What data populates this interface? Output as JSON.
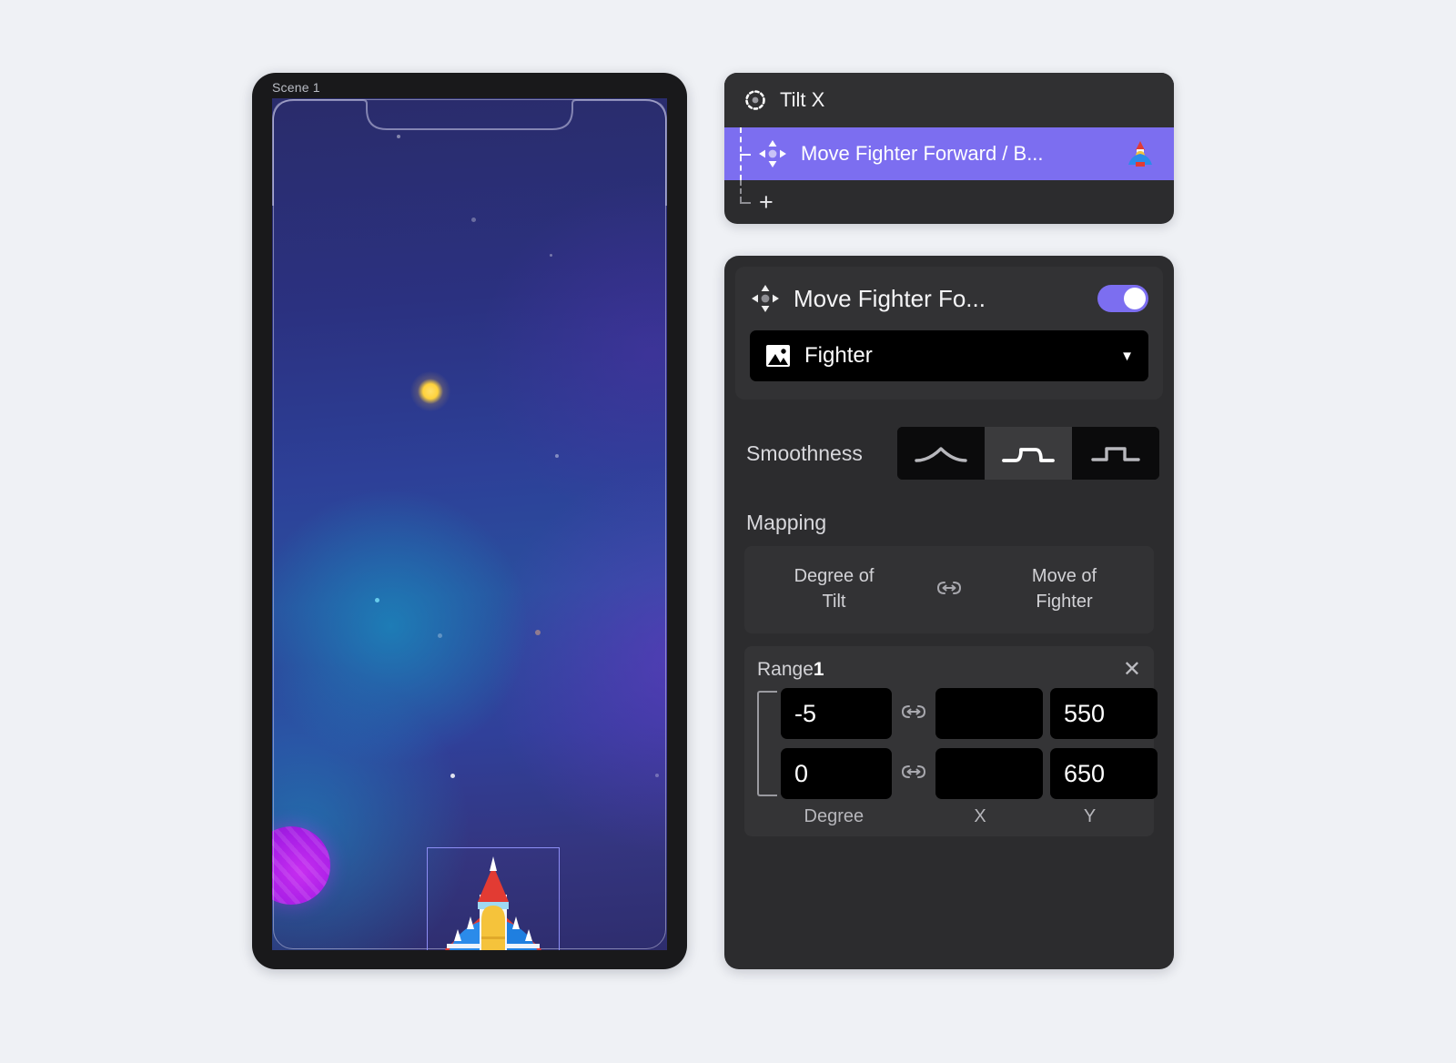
{
  "preview": {
    "scene_label": "Scene 1",
    "selected_sprite": "Fighter",
    "sprite_icon": "fighter-jet-sprite",
    "planet_icon": "purple-planet"
  },
  "layers_panel": {
    "header": {
      "icon": "tilt-sensor-icon",
      "title": "Tilt X"
    },
    "rows": [
      {
        "icon": "move-arrows-icon",
        "label": "Move Fighter Forward / B...",
        "thumbnail": "fighter-thumbnail",
        "selected": true
      }
    ],
    "add_label": "+"
  },
  "inspector": {
    "icon": "move-arrows-icon",
    "title": "Move Fighter Fo...",
    "enabled_toggle": {
      "name": "behavior-enabled-toggle",
      "state": "on"
    },
    "target_select": {
      "icon": "image-icon",
      "value": "Fighter",
      "chevron": "▼"
    },
    "smoothness": {
      "label": "Smoothness",
      "options": [
        {
          "id": "smooth-curve",
          "icon": "smooth-curve-icon",
          "selected": false
        },
        {
          "id": "rounded-step",
          "icon": "rounded-step-icon",
          "selected": true
        },
        {
          "id": "sharp-step",
          "icon": "sharp-step-icon",
          "selected": false
        }
      ]
    },
    "mapping": {
      "title": "Mapping",
      "source_label": "Degree of\nTilt",
      "source_line1": "Degree of",
      "source_line2": "Tilt",
      "link_icon": "bidirectional-link-icon",
      "target_line1": "Move of",
      "target_line2": "Fighter"
    },
    "range": {
      "title_prefix": "Range",
      "title_index": "1",
      "close_icon": "✕",
      "rows": [
        {
          "degree": "-5",
          "x": "",
          "y": "550"
        },
        {
          "degree": "0",
          "x": "",
          "y": "650"
        }
      ],
      "column_labels": {
        "degree": "Degree",
        "x": "X",
        "y": "Y"
      }
    }
  },
  "colors": {
    "page_bg": "#eff1f5",
    "panel_bg": "#2c2c2e",
    "card_bg": "#323234",
    "accent_purple": "#7c6ef0",
    "field_black": "#000000",
    "text_primary": "#f5f5f7",
    "text_secondary": "#d2d2d6"
  }
}
